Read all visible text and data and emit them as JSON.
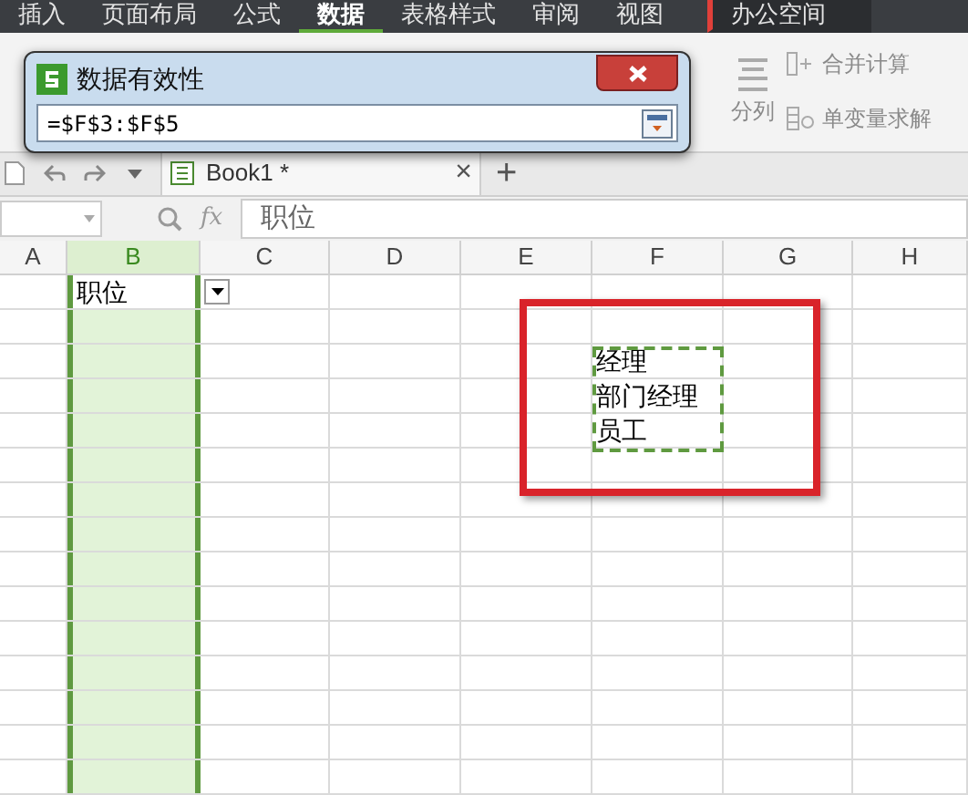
{
  "menu_tabs": [
    {
      "label": "插入",
      "selected": false,
      "kind": "normal"
    },
    {
      "label": "页面布局",
      "selected": false,
      "kind": "normal"
    },
    {
      "label": "公式",
      "selected": false,
      "kind": "normal"
    },
    {
      "label": "数据",
      "selected": true,
      "kind": "normal"
    },
    {
      "label": "表格样式",
      "selected": false,
      "kind": "normal"
    },
    {
      "label": "审阅",
      "selected": false,
      "kind": "normal"
    },
    {
      "label": "视图",
      "selected": false,
      "kind": "normal"
    },
    {
      "label": "办公空间",
      "selected": false,
      "kind": "workspace"
    }
  ],
  "ribbon": {
    "split": "分列",
    "consolidate": "合并计算",
    "goal_seek": "单变量求解"
  },
  "dialog": {
    "title": "数据有效性",
    "value": "=$F$3:$F$5"
  },
  "doc_tab": {
    "title": "Book1 *",
    "close": "×",
    "new_tab": "+"
  },
  "formula_bar": {
    "fx": "fx",
    "value": "职位"
  },
  "columns": [
    {
      "label": "A",
      "selected": false
    },
    {
      "label": "B",
      "selected": true
    },
    {
      "label": "C",
      "selected": false
    },
    {
      "label": "D",
      "selected": false
    },
    {
      "label": "E",
      "selected": false
    },
    {
      "label": "F",
      "selected": false
    },
    {
      "label": "G",
      "selected": false
    },
    {
      "label": "H",
      "selected": false
    }
  ],
  "active_cell": {
    "text": "职位",
    "has_dropdown": true
  },
  "source_range": {
    "items": [
      "经理",
      "部门经理",
      "员工"
    ]
  }
}
